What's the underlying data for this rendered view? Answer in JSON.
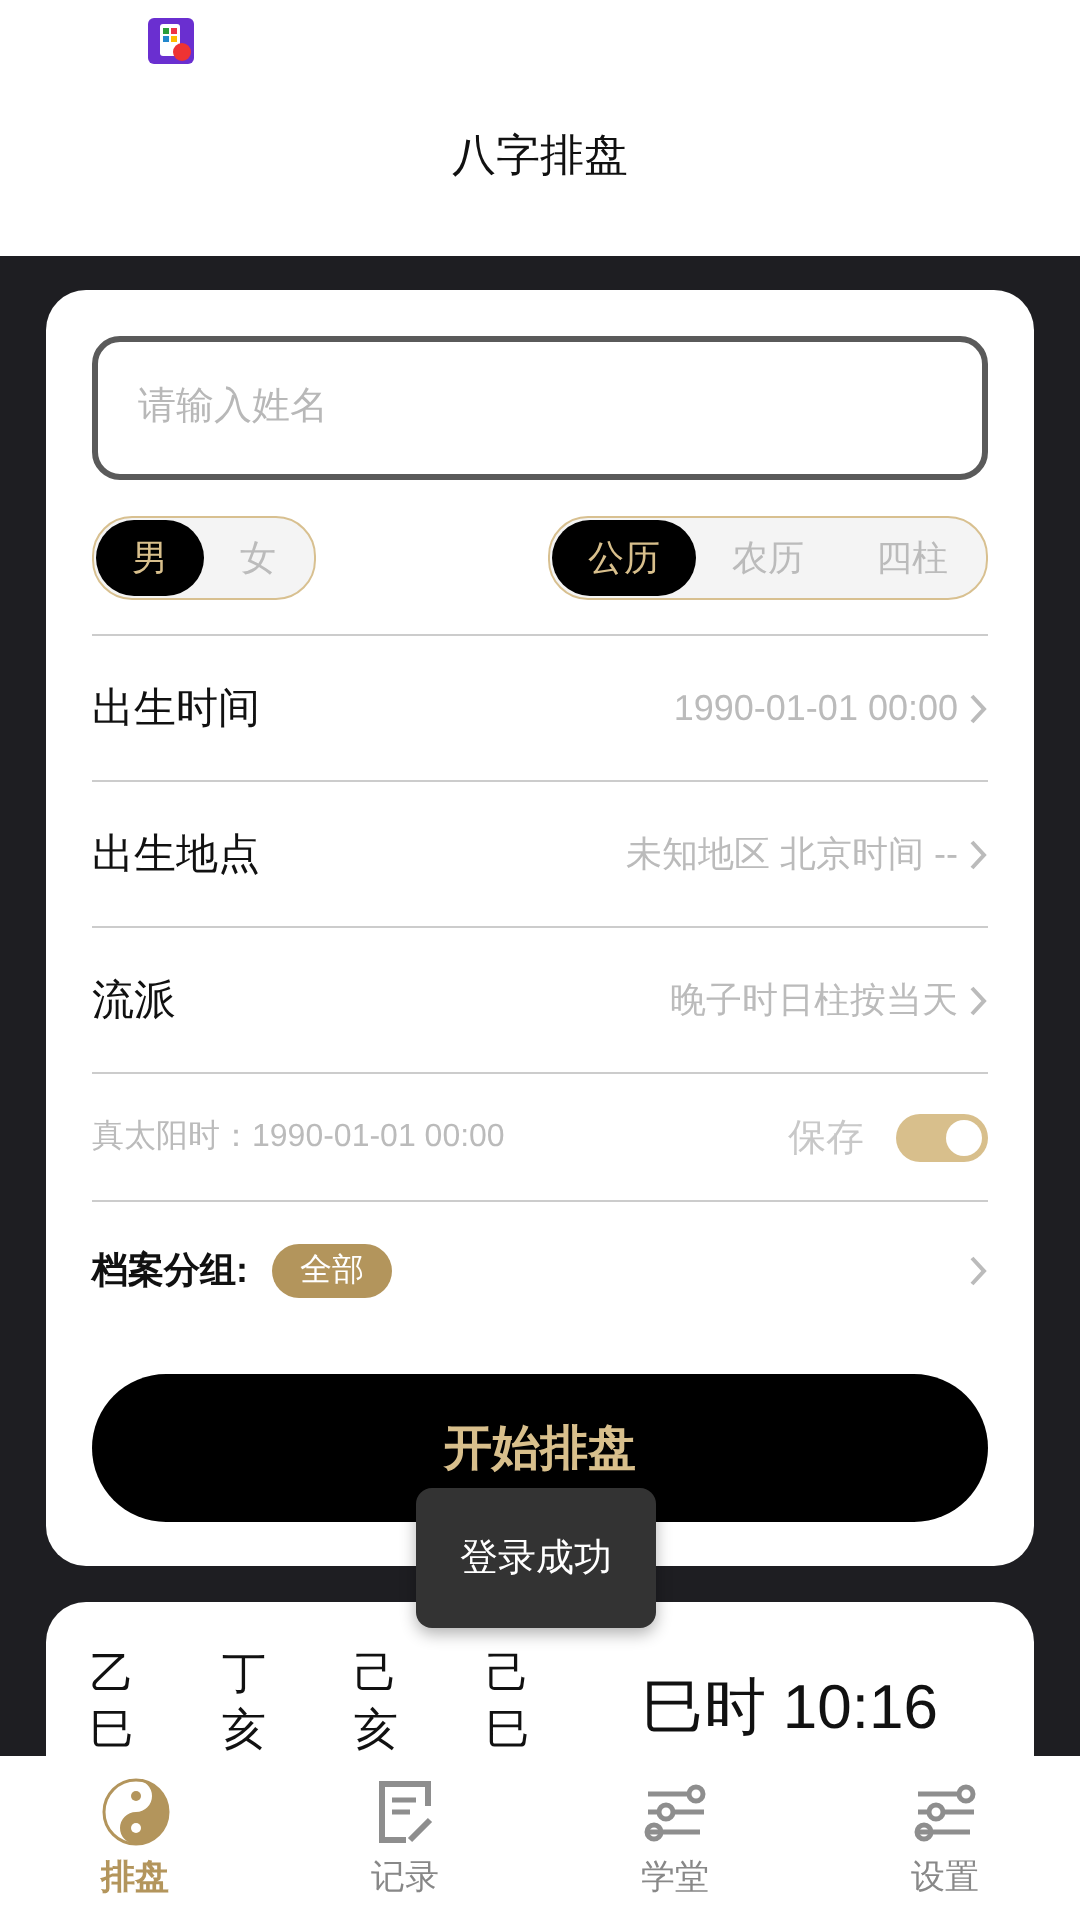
{
  "header": {
    "title": "八字排盘"
  },
  "form": {
    "name_field": {
      "placeholder": "请输入姓名"
    },
    "gender": [
      {
        "label": "男",
        "selected": true
      },
      {
        "label": "女",
        "selected": false
      }
    ],
    "calendar": [
      {
        "label": "公历",
        "selected": true
      },
      {
        "label": "农历",
        "selected": false
      },
      {
        "label": "四柱",
        "selected": false
      }
    ],
    "rows": [
      {
        "label": "出生时间",
        "value": "1990-01-01 00:00"
      },
      {
        "label": "出生地点",
        "value": "未知地区 北京时间 --"
      },
      {
        "label": "流派",
        "value": "晚子时日柱按当天"
      }
    ],
    "solar_time": {
      "text": "真太阳时：1990-01-01 00:00",
      "save_label": "保存",
      "save_on": true
    },
    "group": {
      "label": "档案分组:",
      "tag": "全部"
    },
    "start_button": "开始排盘"
  },
  "pillars": {
    "columns": [
      {
        "stem": "乙",
        "branch": "巳"
      },
      {
        "stem": "丁",
        "branch": "亥"
      },
      {
        "stem": "己",
        "branch": "亥"
      },
      {
        "stem": "己",
        "branch": "巳"
      }
    ],
    "hour_text": "巳时 10:16"
  },
  "toast": "登录成功",
  "nav": [
    {
      "label": "排盘",
      "kind": "yin-yang",
      "selected": true
    },
    {
      "label": "记录",
      "kind": "note",
      "selected": false
    },
    {
      "label": "学堂",
      "kind": "sliders",
      "selected": false
    },
    {
      "label": "设置",
      "kind": "sliders",
      "selected": false
    }
  ]
}
